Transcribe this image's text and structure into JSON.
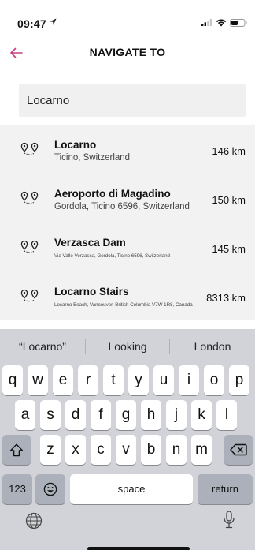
{
  "status_bar": {
    "time": "09:47"
  },
  "nav": {
    "title": "NAVIGATE TO",
    "accent_color": "#c73e82"
  },
  "search": {
    "value": "Locarno"
  },
  "results": [
    {
      "name": "Locarno",
      "subtitle": "Ticino, Switzerland",
      "distance": "146 km"
    },
    {
      "name": "Aeroporto di Magadino",
      "subtitle": "Gordola, Ticino 6596, Switzerland",
      "distance": "150 km"
    },
    {
      "name": "Verzasca Dam",
      "subtitle": "Via Valle Verzasca, Gordola, Ticino 6596, Switzerland",
      "distance": "145 km"
    },
    {
      "name": "Locarno Stairs",
      "subtitle": "Locarno Beach, Vancouver, British Columbia V7W 1R8, Canada",
      "distance": "8313 km"
    }
  ],
  "keyboard": {
    "suggestions": [
      "“Locarno”",
      "Looking",
      "London"
    ],
    "row1": [
      "q",
      "w",
      "e",
      "r",
      "t",
      "y",
      "u",
      "i",
      "o",
      "p"
    ],
    "row2": [
      "a",
      "s",
      "d",
      "f",
      "g",
      "h",
      "j",
      "k",
      "l"
    ],
    "row3": [
      "z",
      "x",
      "c",
      "v",
      "b",
      "n",
      "m"
    ],
    "numbers_key": "123",
    "space_key": "space",
    "return_key": "return",
    "icons": [
      "shift-icon",
      "backspace-icon",
      "emoji-icon",
      "globe-icon",
      "microphone-icon"
    ]
  }
}
